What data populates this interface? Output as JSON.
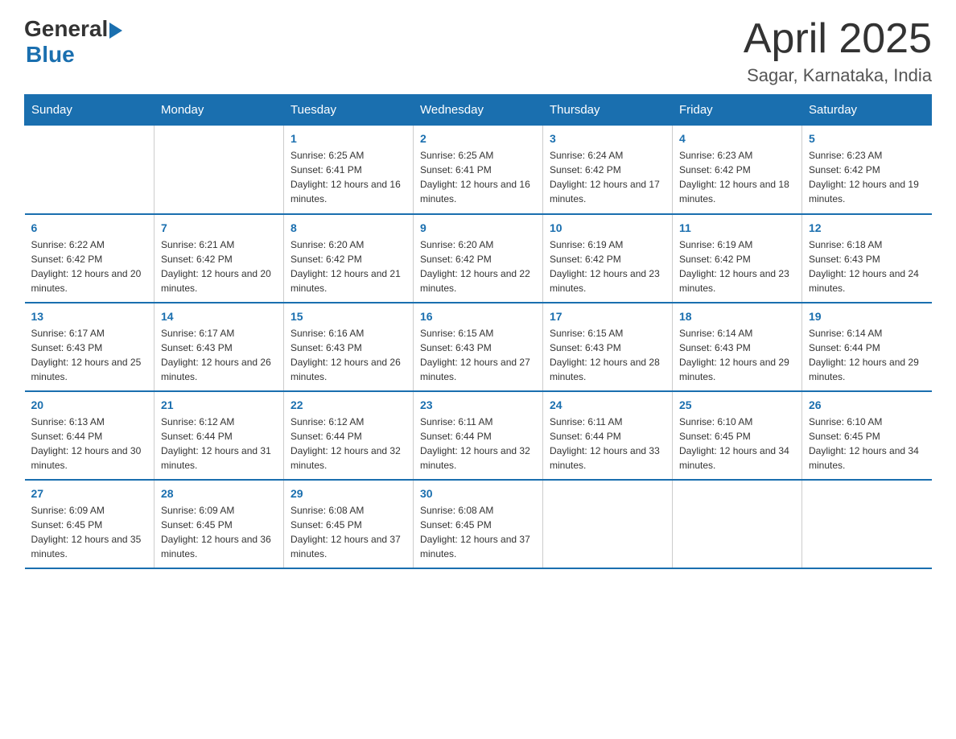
{
  "header": {
    "logo": {
      "general": "General",
      "blue": "Blue"
    },
    "title": "April 2025",
    "location": "Sagar, Karnataka, India"
  },
  "calendar": {
    "days_of_week": [
      "Sunday",
      "Monday",
      "Tuesday",
      "Wednesday",
      "Thursday",
      "Friday",
      "Saturday"
    ],
    "weeks": [
      [
        {
          "day": "",
          "sunrise": "",
          "sunset": "",
          "daylight": ""
        },
        {
          "day": "",
          "sunrise": "",
          "sunset": "",
          "daylight": ""
        },
        {
          "day": "1",
          "sunrise": "Sunrise: 6:25 AM",
          "sunset": "Sunset: 6:41 PM",
          "daylight": "Daylight: 12 hours and 16 minutes."
        },
        {
          "day": "2",
          "sunrise": "Sunrise: 6:25 AM",
          "sunset": "Sunset: 6:41 PM",
          "daylight": "Daylight: 12 hours and 16 minutes."
        },
        {
          "day": "3",
          "sunrise": "Sunrise: 6:24 AM",
          "sunset": "Sunset: 6:42 PM",
          "daylight": "Daylight: 12 hours and 17 minutes."
        },
        {
          "day": "4",
          "sunrise": "Sunrise: 6:23 AM",
          "sunset": "Sunset: 6:42 PM",
          "daylight": "Daylight: 12 hours and 18 minutes."
        },
        {
          "day": "5",
          "sunrise": "Sunrise: 6:23 AM",
          "sunset": "Sunset: 6:42 PM",
          "daylight": "Daylight: 12 hours and 19 minutes."
        }
      ],
      [
        {
          "day": "6",
          "sunrise": "Sunrise: 6:22 AM",
          "sunset": "Sunset: 6:42 PM",
          "daylight": "Daylight: 12 hours and 20 minutes."
        },
        {
          "day": "7",
          "sunrise": "Sunrise: 6:21 AM",
          "sunset": "Sunset: 6:42 PM",
          "daylight": "Daylight: 12 hours and 20 minutes."
        },
        {
          "day": "8",
          "sunrise": "Sunrise: 6:20 AM",
          "sunset": "Sunset: 6:42 PM",
          "daylight": "Daylight: 12 hours and 21 minutes."
        },
        {
          "day": "9",
          "sunrise": "Sunrise: 6:20 AM",
          "sunset": "Sunset: 6:42 PM",
          "daylight": "Daylight: 12 hours and 22 minutes."
        },
        {
          "day": "10",
          "sunrise": "Sunrise: 6:19 AM",
          "sunset": "Sunset: 6:42 PM",
          "daylight": "Daylight: 12 hours and 23 minutes."
        },
        {
          "day": "11",
          "sunrise": "Sunrise: 6:19 AM",
          "sunset": "Sunset: 6:42 PM",
          "daylight": "Daylight: 12 hours and 23 minutes."
        },
        {
          "day": "12",
          "sunrise": "Sunrise: 6:18 AM",
          "sunset": "Sunset: 6:43 PM",
          "daylight": "Daylight: 12 hours and 24 minutes."
        }
      ],
      [
        {
          "day": "13",
          "sunrise": "Sunrise: 6:17 AM",
          "sunset": "Sunset: 6:43 PM",
          "daylight": "Daylight: 12 hours and 25 minutes."
        },
        {
          "day": "14",
          "sunrise": "Sunrise: 6:17 AM",
          "sunset": "Sunset: 6:43 PM",
          "daylight": "Daylight: 12 hours and 26 minutes."
        },
        {
          "day": "15",
          "sunrise": "Sunrise: 6:16 AM",
          "sunset": "Sunset: 6:43 PM",
          "daylight": "Daylight: 12 hours and 26 minutes."
        },
        {
          "day": "16",
          "sunrise": "Sunrise: 6:15 AM",
          "sunset": "Sunset: 6:43 PM",
          "daylight": "Daylight: 12 hours and 27 minutes."
        },
        {
          "day": "17",
          "sunrise": "Sunrise: 6:15 AM",
          "sunset": "Sunset: 6:43 PM",
          "daylight": "Daylight: 12 hours and 28 minutes."
        },
        {
          "day": "18",
          "sunrise": "Sunrise: 6:14 AM",
          "sunset": "Sunset: 6:43 PM",
          "daylight": "Daylight: 12 hours and 29 minutes."
        },
        {
          "day": "19",
          "sunrise": "Sunrise: 6:14 AM",
          "sunset": "Sunset: 6:44 PM",
          "daylight": "Daylight: 12 hours and 29 minutes."
        }
      ],
      [
        {
          "day": "20",
          "sunrise": "Sunrise: 6:13 AM",
          "sunset": "Sunset: 6:44 PM",
          "daylight": "Daylight: 12 hours and 30 minutes."
        },
        {
          "day": "21",
          "sunrise": "Sunrise: 6:12 AM",
          "sunset": "Sunset: 6:44 PM",
          "daylight": "Daylight: 12 hours and 31 minutes."
        },
        {
          "day": "22",
          "sunrise": "Sunrise: 6:12 AM",
          "sunset": "Sunset: 6:44 PM",
          "daylight": "Daylight: 12 hours and 32 minutes."
        },
        {
          "day": "23",
          "sunrise": "Sunrise: 6:11 AM",
          "sunset": "Sunset: 6:44 PM",
          "daylight": "Daylight: 12 hours and 32 minutes."
        },
        {
          "day": "24",
          "sunrise": "Sunrise: 6:11 AM",
          "sunset": "Sunset: 6:44 PM",
          "daylight": "Daylight: 12 hours and 33 minutes."
        },
        {
          "day": "25",
          "sunrise": "Sunrise: 6:10 AM",
          "sunset": "Sunset: 6:45 PM",
          "daylight": "Daylight: 12 hours and 34 minutes."
        },
        {
          "day": "26",
          "sunrise": "Sunrise: 6:10 AM",
          "sunset": "Sunset: 6:45 PM",
          "daylight": "Daylight: 12 hours and 34 minutes."
        }
      ],
      [
        {
          "day": "27",
          "sunrise": "Sunrise: 6:09 AM",
          "sunset": "Sunset: 6:45 PM",
          "daylight": "Daylight: 12 hours and 35 minutes."
        },
        {
          "day": "28",
          "sunrise": "Sunrise: 6:09 AM",
          "sunset": "Sunset: 6:45 PM",
          "daylight": "Daylight: 12 hours and 36 minutes."
        },
        {
          "day": "29",
          "sunrise": "Sunrise: 6:08 AM",
          "sunset": "Sunset: 6:45 PM",
          "daylight": "Daylight: 12 hours and 37 minutes."
        },
        {
          "day": "30",
          "sunrise": "Sunrise: 6:08 AM",
          "sunset": "Sunset: 6:45 PM",
          "daylight": "Daylight: 12 hours and 37 minutes."
        },
        {
          "day": "",
          "sunrise": "",
          "sunset": "",
          "daylight": ""
        },
        {
          "day": "",
          "sunrise": "",
          "sunset": "",
          "daylight": ""
        },
        {
          "day": "",
          "sunrise": "",
          "sunset": "",
          "daylight": ""
        }
      ]
    ]
  }
}
